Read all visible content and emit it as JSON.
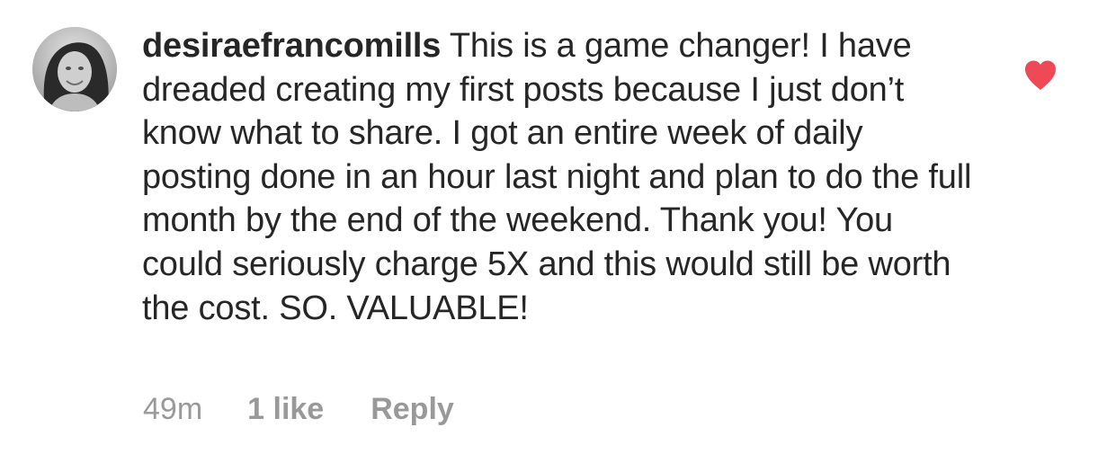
{
  "comment": {
    "username": "desiraefrancomills",
    "text": "This is a game changer! I have dreaded creating my first posts because I just don’t know what to share. I got an entire week of daily posting done in an hour last night and plan to do the full month by the end of the weekend. Thank you! You could seriously charge 5X and this would still be worth the cost. SO. VALUABLE!",
    "time": "49m",
    "likes": "1 like",
    "reply_label": "Reply",
    "liked": true
  },
  "icons": {
    "avatar": "profile-photo",
    "like": "heart-icon"
  },
  "colors": {
    "heart": "#ed4956",
    "text": "#262626",
    "meta": "#999999"
  }
}
